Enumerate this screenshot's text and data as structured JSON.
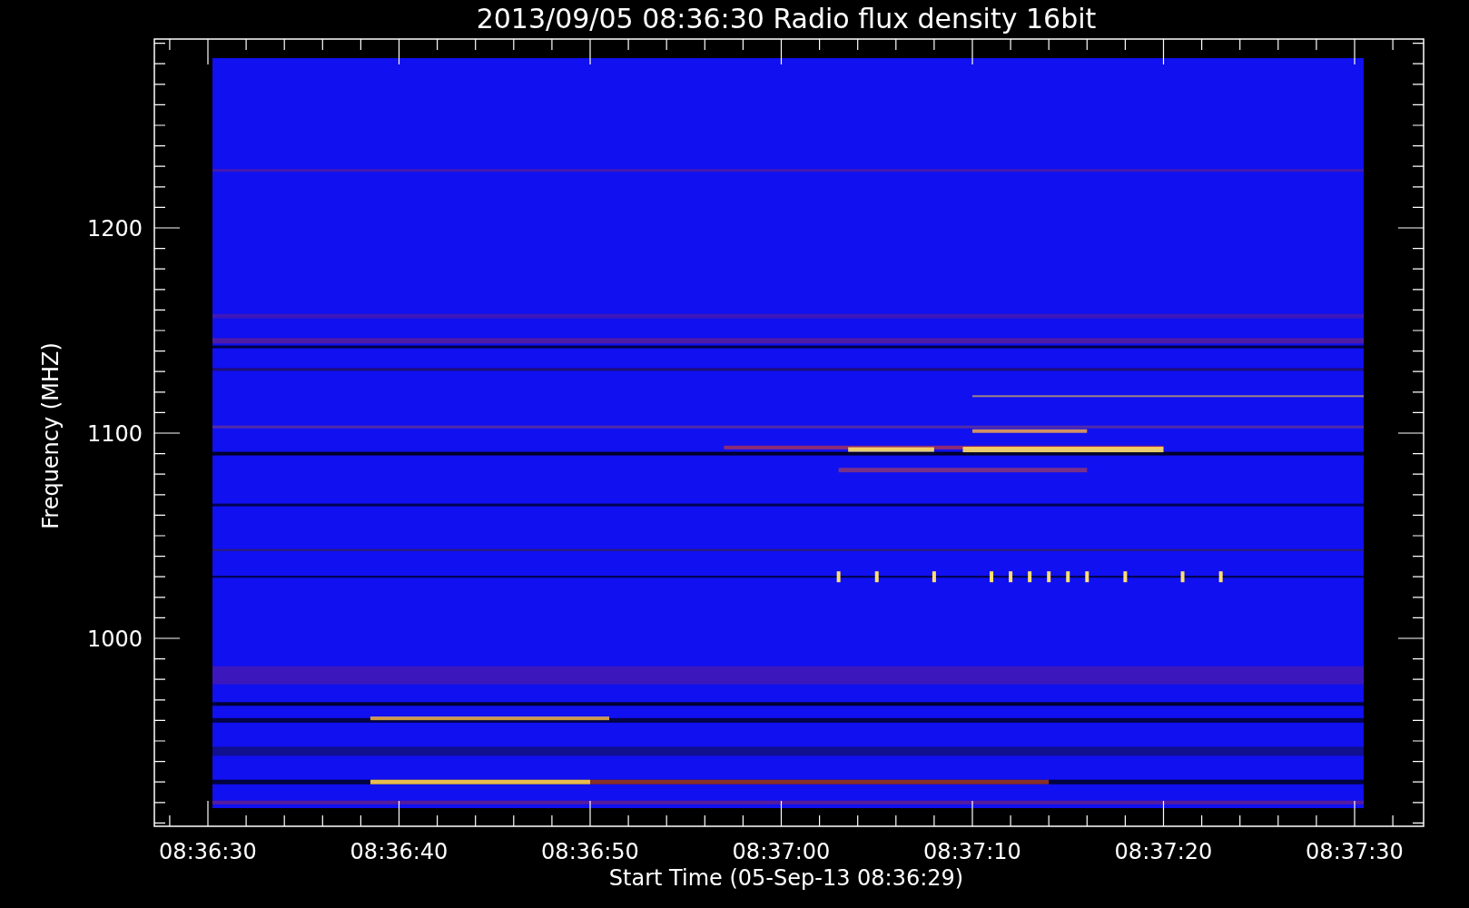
{
  "title": "2013/09/05 08:36:30 Radio flux density 16bit",
  "y_axis": {
    "label": "Frequency (MHZ)",
    "ticks": [
      "1200",
      "1100",
      "1000"
    ]
  },
  "x_axis": {
    "label": "Start Time (05-Sep-13 08:36:29)",
    "ticks": [
      "08:36:30",
      "08:36:40",
      "08:36:50",
      "08:37:00",
      "08:37:10",
      "08:37:20",
      "08:37:30"
    ]
  }
}
